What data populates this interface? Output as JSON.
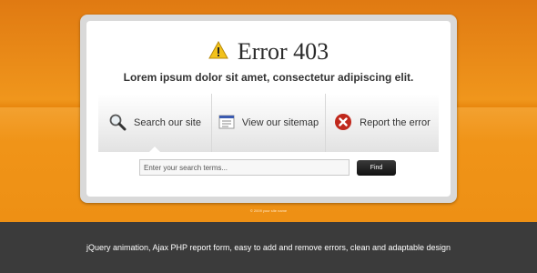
{
  "header": {
    "title": "Error 403",
    "subtitle": "Lorem ipsum dolor sit amet, consectetur adipiscing elit.",
    "title_icon": "warning-icon"
  },
  "tabs": [
    {
      "label": "Search our site",
      "icon": "magnifier-icon",
      "active": true
    },
    {
      "label": "View our sitemap",
      "icon": "sitemap-icon",
      "active": false
    },
    {
      "label": "Report the error",
      "icon": "error-x-icon",
      "active": false
    }
  ],
  "search": {
    "placeholder": "Enter your search terms...",
    "button_label": "Find"
  },
  "copyright": "© 2009 your site name",
  "footer": {
    "text": "jQuery animation, Ajax PHP report form, easy to add and remove errors, clean and adaptable design"
  },
  "colors": {
    "background_orange": "#f09418",
    "footer_bar": "#3b3b3b",
    "error_icon": "#c0281c",
    "warning_icon": "#f2c21b",
    "sitemap_icon": "#3b5bb0"
  }
}
